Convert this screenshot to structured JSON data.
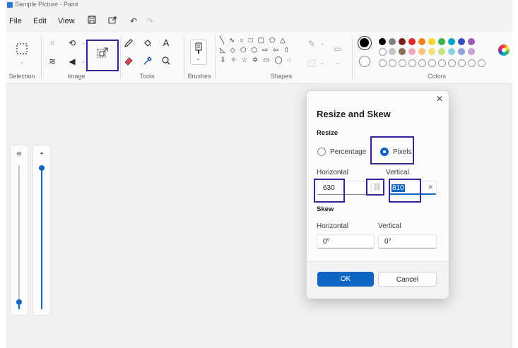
{
  "window": {
    "title": "Sample Picture - Paint"
  },
  "menu": {
    "file": "File",
    "edit": "Edit",
    "view": "View"
  },
  "ribbon": {
    "groups": {
      "selection": "Selection",
      "image": "Image",
      "tools": "Tools",
      "brushes": "Brushes",
      "shapes": "Shapes",
      "colors": "Colors"
    },
    "text_tool_glyph": "A",
    "shapes_rows": [
      "╲ ∿ ○ □ ▢ ⬠ △",
      "◺ ◇ ⬠ ⬡ ⇨ ⇦ ⇧",
      "⇩ ✧ ☆ ✡ ▭ ◯ ◌"
    ]
  },
  "colors": {
    "accent": "#0f65c4",
    "highlight_box": "#3b2196",
    "palette_row1": [
      "#000000",
      "#7f7f7f",
      "#7a1d1d",
      "#e0242b",
      "#f2811d",
      "#f6d52b",
      "#38b44a",
      "#00a2c7",
      "#3b4cc0",
      "#9b59b6"
    ],
    "palette_row2": [
      "#c3c3c3",
      "#8c6e58",
      "#f3a6c8",
      "#f9c27f",
      "#f1e27b",
      "#c6e27f",
      "#8fd0e0",
      "#8fa3d8",
      "#c4a3d6"
    ]
  },
  "dialog": {
    "title": "Resize and Skew",
    "close_glyph": "✕",
    "resize": {
      "heading": "Resize",
      "percentage_label": "Percentage",
      "pixels_label": "Pixels",
      "selected": "Pixels",
      "horizontal_label": "Horizontal",
      "vertical_label": "Vertical",
      "horizontal_value": "630",
      "vertical_value": "810",
      "link_glyph": "⛓",
      "clear_glyph": "✕"
    },
    "skew": {
      "heading": "Skew",
      "horizontal_label": "Horizontal",
      "vertical_label": "Vertical",
      "horizontal_value": "0°",
      "vertical_value": "0°"
    },
    "ok_label": "OK",
    "cancel_label": "Cancel"
  }
}
